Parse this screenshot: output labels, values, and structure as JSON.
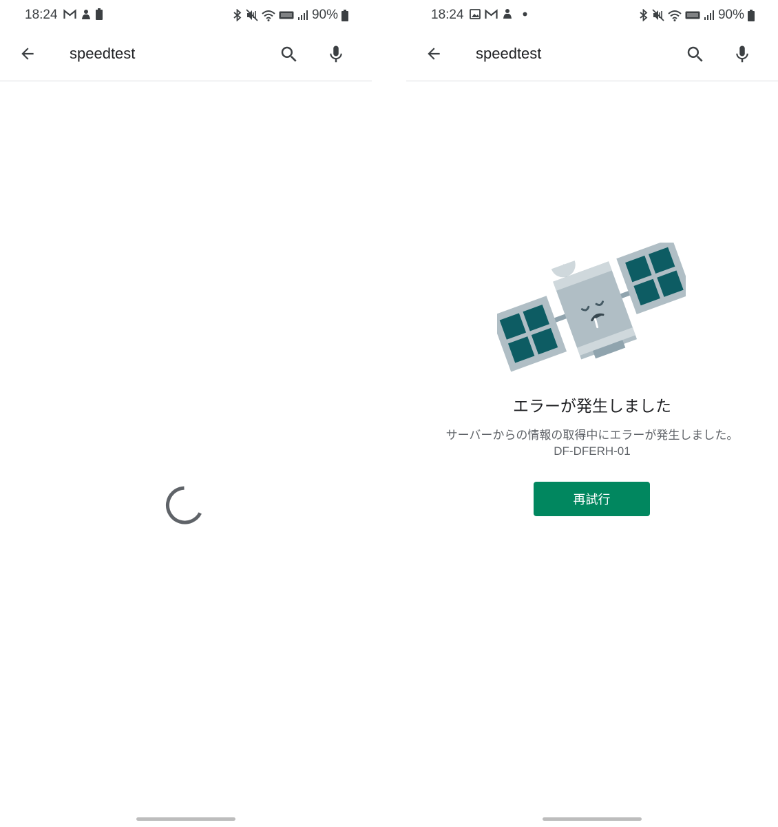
{
  "colors": {
    "accent": "#01875f",
    "text_primary": "#202124",
    "text_secondary": "#5f6368",
    "divider": "#dadce0",
    "spinner": "#5f6368"
  },
  "left_screen": {
    "status_bar": {
      "time": "18:24",
      "left_icons": [
        "gmail-icon",
        "notification-app-icon",
        "battery-small-icon"
      ],
      "right_icons": [
        "bluetooth-icon",
        "mute-icon",
        "wifi-icon",
        "volte-icon",
        "signal-icon"
      ],
      "battery_percent": "90%"
    },
    "search_bar": {
      "query": "speedtest"
    },
    "state": "loading"
  },
  "right_screen": {
    "status_bar": {
      "time": "18:24",
      "left_icons": [
        "image-icon",
        "gmail-icon",
        "notification-app-icon",
        "dot-icon"
      ],
      "right_icons": [
        "bluetooth-icon",
        "mute-icon",
        "wifi-icon",
        "volte-icon",
        "signal-icon"
      ],
      "battery_percent": "90%"
    },
    "search_bar": {
      "query": "speedtest"
    },
    "error": {
      "illustration": "sad-satellite-illustration",
      "title": "エラーが発生しました",
      "message": "サーバーからの情報の取得中にエラーが発生しました。",
      "code": "DF-DFERH-01",
      "retry_label": "再試行"
    }
  }
}
